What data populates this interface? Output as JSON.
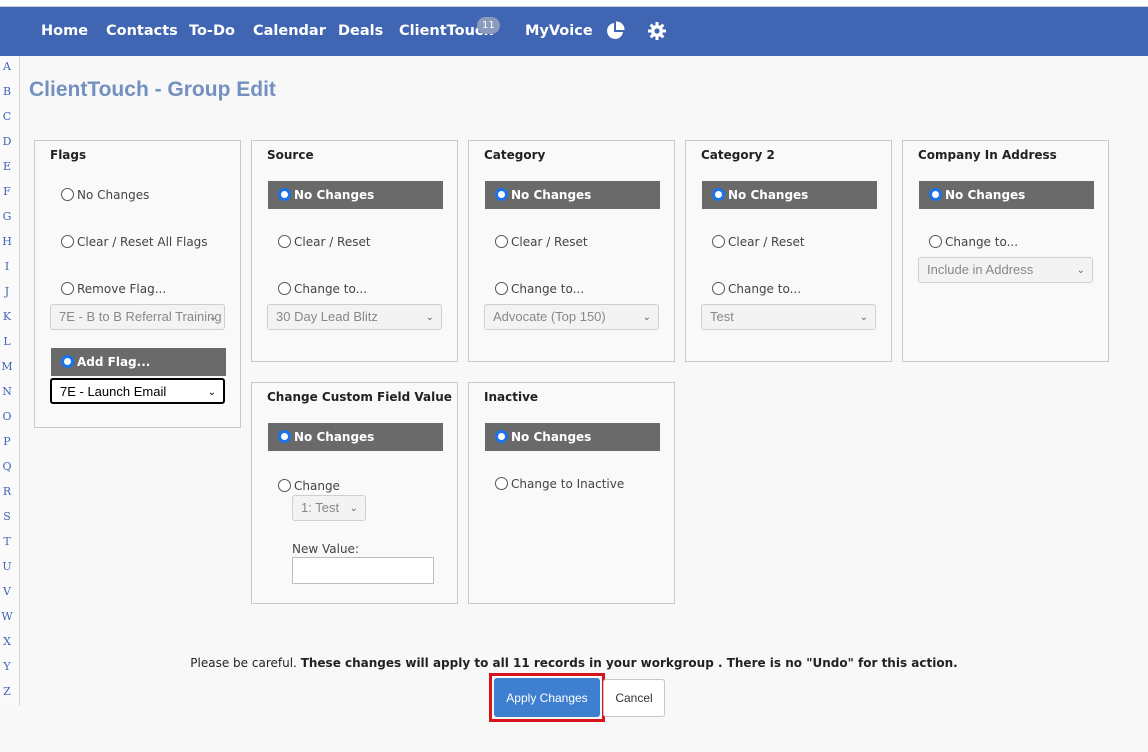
{
  "nav": {
    "items": [
      "Home",
      "Contacts",
      "To-Do",
      "Calendar",
      "Deals",
      "ClientTouch",
      "MyVoice"
    ],
    "clienttouch_badge": "11",
    "icons": [
      "pie-chart-icon",
      "gear-icon"
    ]
  },
  "alphabet": [
    "A",
    "B",
    "C",
    "D",
    "E",
    "F",
    "G",
    "H",
    "I",
    "J",
    "K",
    "L",
    "M",
    "N",
    "O",
    "P",
    "Q",
    "R",
    "S",
    "T",
    "U",
    "V",
    "W",
    "X",
    "Y",
    "Z"
  ],
  "page_title": "ClientTouch - Group Edit",
  "flags": {
    "title": "Flags",
    "no_changes": "No Changes",
    "clear_reset_all": "Clear / Reset All Flags",
    "remove_flag": "Remove Flag...",
    "remove_flag_select": "7E - B to B Referral Training",
    "add_flag": "Add Flag...",
    "add_flag_select": "7E - Launch Email"
  },
  "source": {
    "title": "Source",
    "no_changes": "No Changes",
    "clear_reset": "Clear / Reset",
    "change_to": "Change to...",
    "select": "30 Day Lead Blitz"
  },
  "category": {
    "title": "Category",
    "no_changes": "No Changes",
    "clear_reset": "Clear / Reset",
    "change_to": "Change to...",
    "select": "Advocate (Top 150)"
  },
  "category2": {
    "title": "Category 2",
    "no_changes": "No Changes",
    "clear_reset": "Clear / Reset",
    "change_to": "Change to...",
    "select": "Test"
  },
  "company": {
    "title": "Company In Address",
    "no_changes": "No Changes",
    "change_to": "Change to...",
    "select": "Include in Address"
  },
  "custom_field": {
    "title": "Change Custom Field Value",
    "no_changes": "No Changes",
    "change": "Change",
    "select": "1: Test",
    "new_value_label": "New Value:",
    "new_value": ""
  },
  "inactive": {
    "title": "Inactive",
    "no_changes": "No Changes",
    "change_to_inactive": "Change to Inactive"
  },
  "warning": {
    "prefix": "Please be careful.",
    "bold": "These changes will apply to all 11 records in your workgroup . There is no \"Undo\" for this action."
  },
  "buttons": {
    "apply": "Apply Changes",
    "cancel": "Cancel"
  },
  "colors": {
    "navbar": "#3f65b3",
    "title": "#7390c0",
    "selected_option": "#6a6a6a",
    "apply_button": "#3f7fcf",
    "highlight_outline": "#d7141b"
  }
}
